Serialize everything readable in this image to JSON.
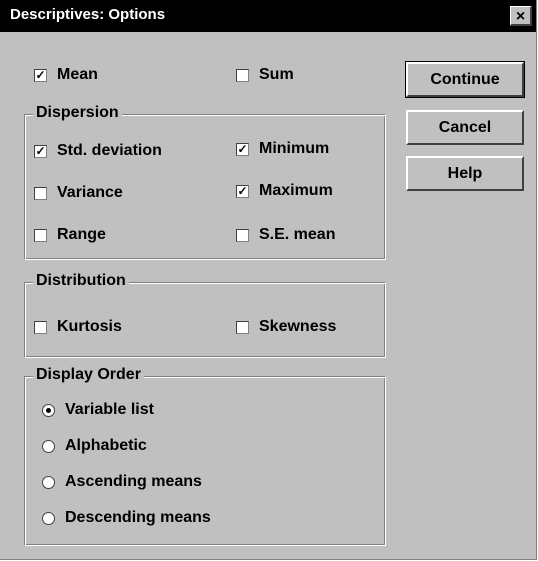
{
  "window": {
    "title": "Descriptives: Options",
    "close_glyph": "×"
  },
  "options": {
    "mean": {
      "label": "Mean",
      "checked": true
    },
    "sum": {
      "label": "Sum",
      "checked": false
    }
  },
  "dispersion": {
    "legend": "Dispersion",
    "std_deviation": {
      "label": "Std. deviation",
      "checked": true
    },
    "minimum": {
      "label": "Minimum",
      "checked": true
    },
    "variance": {
      "label": "Variance",
      "checked": false
    },
    "maximum": {
      "label": "Maximum",
      "checked": true
    },
    "range": {
      "label": "Range",
      "checked": false
    },
    "se_mean": {
      "label": "S.E. mean",
      "checked": false
    }
  },
  "distribution": {
    "legend": "Distribution",
    "kurtosis": {
      "label": "Kurtosis",
      "checked": false
    },
    "skewness": {
      "label": "Skewness",
      "checked": false
    }
  },
  "display_order": {
    "legend": "Display Order",
    "selected": "variable_list",
    "variable_list": "Variable list",
    "alphabetic": "Alphabetic",
    "ascending": "Ascending means",
    "descending": "Descending means"
  },
  "buttons": {
    "continue": "Continue",
    "cancel": "Cancel",
    "help": "Help"
  }
}
